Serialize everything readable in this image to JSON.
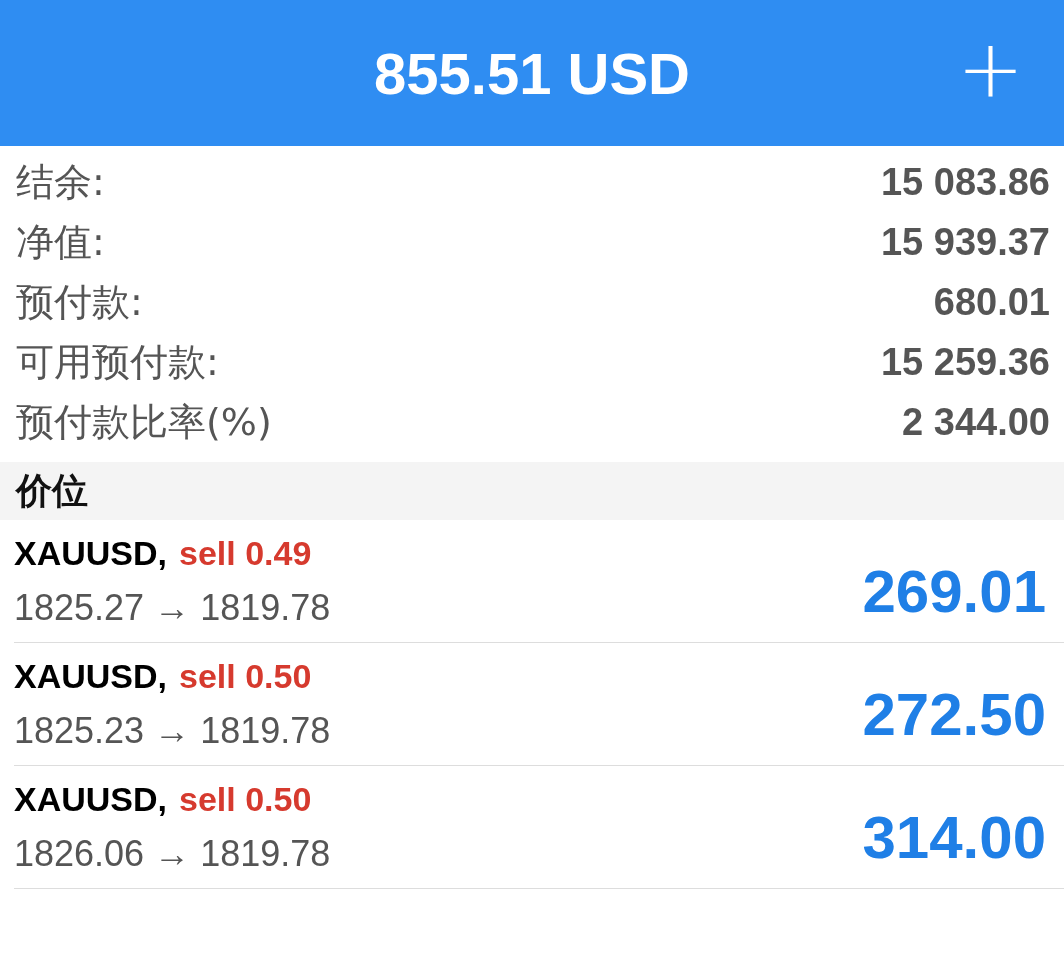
{
  "header": {
    "title": "855.51 USD",
    "action": "+"
  },
  "summary": [
    {
      "label": "结余:",
      "value": "15 083.86"
    },
    {
      "label": "净值:",
      "value": "15 939.37"
    },
    {
      "label": "预付款:",
      "value": "680.01"
    },
    {
      "label": "可用预付款:",
      "value": "15 259.36"
    },
    {
      "label": "预付款比率(%)",
      "value": "2 344.00"
    }
  ],
  "section": "价位",
  "positions": [
    {
      "symbol": "XAUUSD,",
      "order": "sell 0.49",
      "prices": "1825.27 → 1819.78",
      "profit": "269.01"
    },
    {
      "symbol": "XAUUSD,",
      "order": "sell 0.50",
      "prices": "1825.23 → 1819.78",
      "profit": "272.50"
    },
    {
      "symbol": "XAUUSD,",
      "order": "sell 0.50",
      "prices": "1826.06 → 1819.78",
      "profit": "314.00"
    }
  ]
}
